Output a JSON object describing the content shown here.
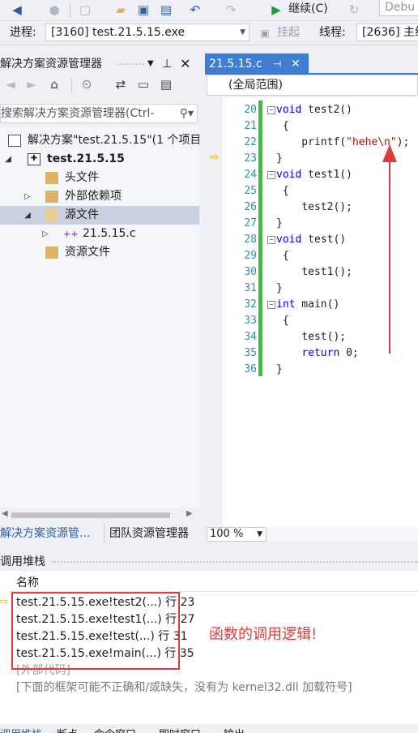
{
  "toolbar": {
    "continue_label": "继续(C)",
    "config_value": "Debu",
    "process_label": "进程:",
    "process_value": "[3160] test.21.5.15.exe",
    "suspend_label": "挂起",
    "thread_label": "线程:",
    "thread_value": "[2636] 主线"
  },
  "solution_explorer": {
    "title": "解决方案资源管理器",
    "search_placeholder": "搜索解决方案资源管理器(Ctrl-",
    "tree": [
      {
        "label": "解决方案\"test.21.5.15\"(1 个项目",
        "icon": "solution-icon",
        "bold": false
      },
      {
        "label": "test.21.5.15",
        "icon": "project-icon",
        "bold": true
      },
      {
        "label": "头文件",
        "icon": "folder-icon"
      },
      {
        "label": "外部依赖项",
        "icon": "folder-icon"
      },
      {
        "label": "源文件",
        "icon": "folder-icon"
      },
      {
        "label": "21.5.15.c",
        "icon": "cfile-icon"
      },
      {
        "label": "资源文件",
        "icon": "folder-icon"
      }
    ],
    "bottom_tabs": [
      "解决方案资源管...",
      "团队资源管理器"
    ]
  },
  "editor": {
    "tab_label": "21.5.15.c",
    "scope": "(全局范围)",
    "zoom": "100 %",
    "current_line": 23,
    "lines": [
      {
        "n": "20",
        "fold": "−",
        "text": "void test2()"
      },
      {
        "n": "21",
        "fold": "",
        "text": " {"
      },
      {
        "n": "22",
        "fold": "",
        "text": "    printf(\"hehe\\n\");"
      },
      {
        "n": "23",
        "fold": "",
        "text": "}"
      },
      {
        "n": "24",
        "fold": "−",
        "text": "void test1()"
      },
      {
        "n": "25",
        "fold": "",
        "text": " {"
      },
      {
        "n": "26",
        "fold": "",
        "text": "    test2();"
      },
      {
        "n": "27",
        "fold": "",
        "text": "}"
      },
      {
        "n": "28",
        "fold": "−",
        "text": "void test()"
      },
      {
        "n": "29",
        "fold": "",
        "text": " {"
      },
      {
        "n": "30",
        "fold": "",
        "text": "    test1();"
      },
      {
        "n": "31",
        "fold": "",
        "text": "}"
      },
      {
        "n": "32",
        "fold": "−",
        "text": "int main()"
      },
      {
        "n": "33",
        "fold": "",
        "text": " {"
      },
      {
        "n": "34",
        "fold": "",
        "text": "    test();"
      },
      {
        "n": "35",
        "fold": "",
        "text": "    return 0;"
      },
      {
        "n": "36",
        "fold": "",
        "text": "}"
      }
    ]
  },
  "call_stack": {
    "title": "调用堆栈",
    "column_header": "名称",
    "frames": [
      "test.21.5.15.exe!test2(...) 行 23",
      "test.21.5.15.exe!test1(...) 行 27",
      "test.21.5.15.exe!test(...) 行 31",
      "test.21.5.15.exe!main(...) 行 35"
    ],
    "external_code": "[外部代码]",
    "note": "[下面的框架可能不正确和/或缺失，没有为 kernel32.dll 加载符号]",
    "annotation": "函数的调用逻辑!"
  },
  "bottom_tabs": [
    "调用堆栈",
    "断点",
    "命令窗口",
    "即时窗口",
    "输出"
  ],
  "colors": {
    "accent": "#3d7ed3",
    "annotation": "#e03b3b",
    "change_bar": "#3cbf3c"
  }
}
